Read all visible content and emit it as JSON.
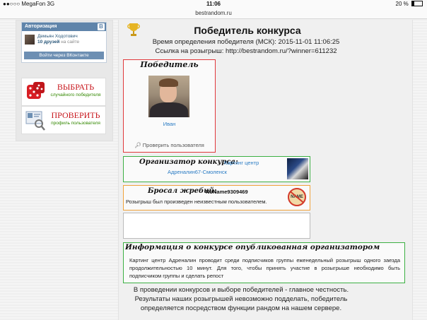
{
  "status_bar": {
    "carrier": "●●○○○ MegaFon  3G",
    "time": "11:06",
    "battery": "20 %"
  },
  "browser": {
    "url": "bestrandom.ru"
  },
  "vk": {
    "header": "Авторизация",
    "logo": "B",
    "user_name": "Демьян Ходотович",
    "friends_count": "10 друзей",
    "friends_suffix": " на сайте",
    "login_button": "Войти через ВКонтакте"
  },
  "side_buttons": [
    {
      "big": "ВЫБРАТЬ",
      "small": "случайного победителя"
    },
    {
      "big": "ПРОВЕРИТЬ",
      "small": "профиль пользователя"
    }
  ],
  "header": {
    "title": "Победитель конкурса",
    "time_line": "Время определения победителя (МСК): 2015-11-01 11:06:25",
    "link_line": "Ссылка на розыгрыш: http://bestrandom.ru/?winner=611232"
  },
  "winner": {
    "heading": "Победитель",
    "name": "Иван",
    "check_link": "Проверить пользователя"
  },
  "organizer": {
    "label": "Организатор конкурса:",
    "name_line1": "Картинг центр",
    "name_line2": "Адреналин67-Смоленск"
  },
  "thrower": {
    "label": "Бросал жребий:",
    "name": "NoName9309469",
    "description": "Розыгрыш был произведен неизвестным пользователем.",
    "icon_text": "NAME"
  },
  "info": {
    "title": "Информация о конкурсе опубликованная организатором",
    "text": "Картинг центр Адреналин проводит среди подписчиков группы еженедельный розыгрыш одного заезда продолжительностью 10 минут. Для того, чтобы принять участие в розыгрыше необходимо быть подписчиком группы и сделать репост"
  },
  "footer": {
    "line1": "В проведении конкурсов и выборе победителей - главное честность.",
    "line2": "Результаты наших розыгрышей невозможно подделать, победитель",
    "line3": "определяется посредством функции рандом на нашем сервере."
  }
}
